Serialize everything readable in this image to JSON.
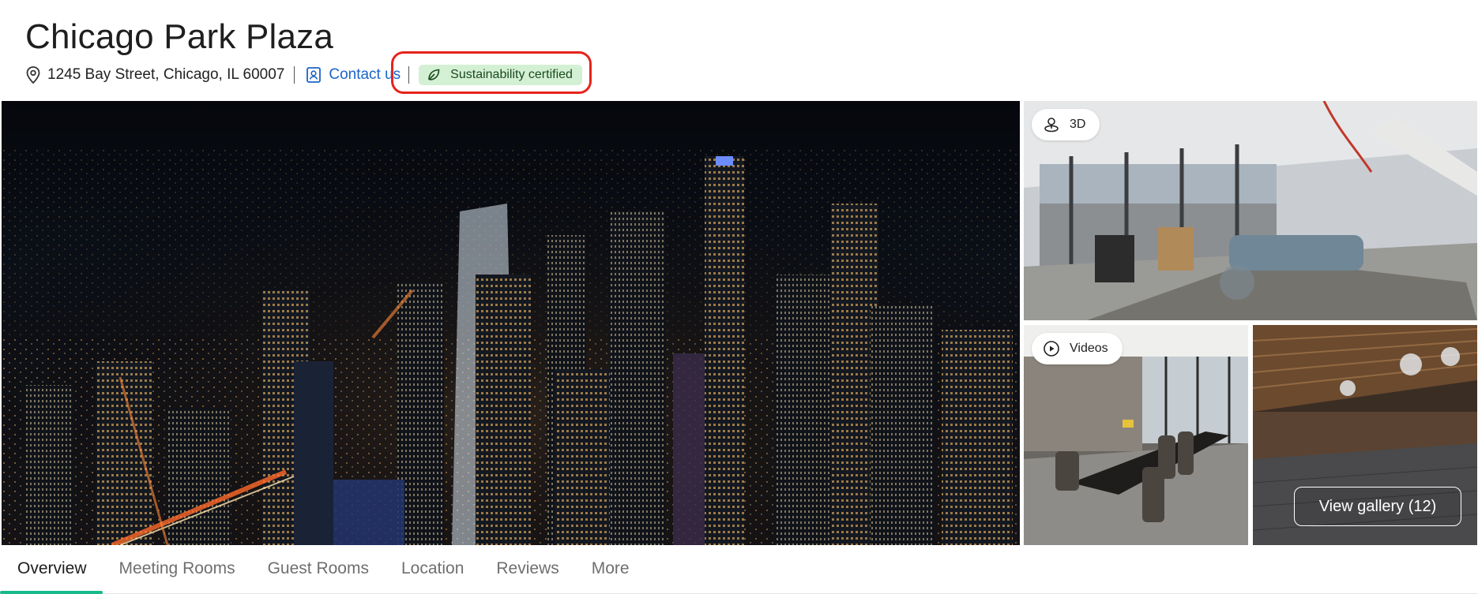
{
  "venue": {
    "name": "Chicago Park Plaza",
    "address": "1245 Bay Street, Chicago, IL 60007",
    "contact_label": "Contact us",
    "badge_label": "Sustainability certified"
  },
  "gallery": {
    "pill_3d": "3D",
    "pill_videos": "Videos",
    "view_gallery_label": "View gallery (12)"
  },
  "tabs": [
    {
      "label": "Overview",
      "active": true
    },
    {
      "label": "Meeting Rooms"
    },
    {
      "label": "Guest Rooms"
    },
    {
      "label": "Location"
    },
    {
      "label": "Reviews"
    },
    {
      "label": "More"
    }
  ],
  "colors": {
    "link": "#1a64c8",
    "badge_bg": "#d4f0d4",
    "highlight_ring": "#e5241b",
    "tab_indicator": "#18b98a"
  },
  "icons": [
    "location-pin-icon",
    "contact-card-icon",
    "leaf-icon",
    "3d-tour-icon",
    "play-circle-icon"
  ]
}
